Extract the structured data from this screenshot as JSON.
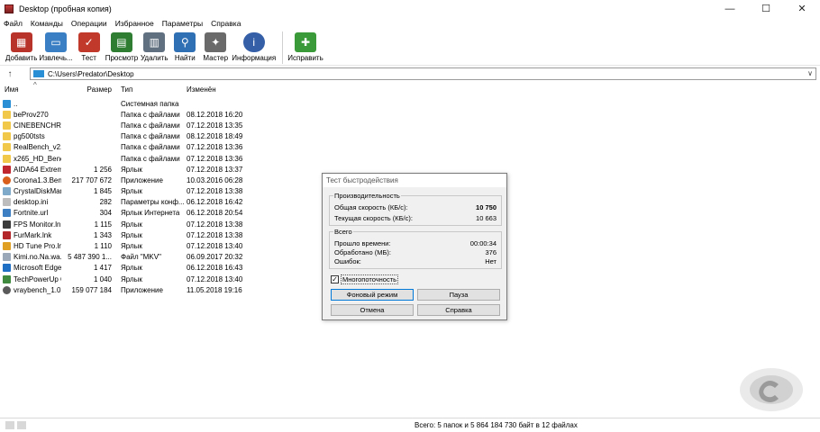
{
  "window": {
    "title": "Desktop (пробная копия)",
    "minimize": "—",
    "maximize": "☐",
    "close": "✕"
  },
  "menu": [
    "Файл",
    "Команды",
    "Операции",
    "Избранное",
    "Параметры",
    "Справка"
  ],
  "toolbar": [
    {
      "label": "Добавить",
      "icon": "archive-add-icon",
      "color": "#b8342a"
    },
    {
      "label": "Извлечь...",
      "icon": "folder-extract-icon",
      "color": "#3a7fc4"
    },
    {
      "label": "Тест",
      "icon": "test-icon",
      "color": "#c0392b"
    },
    {
      "label": "Просмотр",
      "icon": "view-book-icon",
      "color": "#2e7d32"
    },
    {
      "label": "Удалить",
      "icon": "trash-icon",
      "color": "#607080"
    },
    {
      "label": "Найти",
      "icon": "magnifier-icon",
      "color": "#2f6fb3"
    },
    {
      "label": "Мастер",
      "icon": "wizard-wand-icon",
      "color": "#6a6a6a"
    },
    {
      "label": "Информация",
      "icon": "info-icon",
      "color": "#3560a8"
    },
    {
      "label": "Исправить",
      "icon": "repair-icon",
      "color": "#3a9a3a"
    }
  ],
  "address": {
    "path": "C:\\Users\\Predator\\Desktop",
    "dropdown": "∨",
    "up": "↑"
  },
  "columns": {
    "name": "Имя",
    "size": "Размер",
    "type": "Тип",
    "modified": "Изменён",
    "sort_caret": "^"
  },
  "files": [
    {
      "name": "..",
      "size": "",
      "type": "Системная папка",
      "modified": "",
      "icon": "system-folder-icon",
      "color": "#2b8fd6"
    },
    {
      "name": "beProv270",
      "size": "",
      "type": "Папка с файлами",
      "modified": "08.12.2018 16:20",
      "icon": "folder-icon",
      "color": "#f2c84b"
    },
    {
      "name": "CINEBENCHR15...",
      "size": "",
      "type": "Папка с файлами",
      "modified": "07.12.2018 13:35",
      "icon": "folder-icon",
      "color": "#f2c84b"
    },
    {
      "name": "pg500tsts",
      "size": "",
      "type": "Папка с файлами",
      "modified": "08.12.2018 18:49",
      "icon": "folder-icon",
      "color": "#f2c84b"
    },
    {
      "name": "RealBench_v2.43",
      "size": "",
      "type": "Папка с файлами",
      "modified": "07.12.2018 13:36",
      "icon": "folder-icon",
      "color": "#f2c84b"
    },
    {
      "name": "x265_HD_Bench...",
      "size": "",
      "type": "Папка с файлами",
      "modified": "07.12.2018 13:36",
      "icon": "folder-icon",
      "color": "#f2c84b"
    },
    {
      "name": "AIDA64 Extreme...",
      "size": "1 256",
      "type": "Ярлык",
      "modified": "07.12.2018 13:37",
      "icon": "aida64-icon",
      "color": "#c0262d"
    },
    {
      "name": "Corona1.3.Benc...",
      "size": "217 707 672",
      "type": "Приложение",
      "modified": "10.03.2016 06:28",
      "icon": "corona-icon",
      "color": "#d8601c"
    },
    {
      "name": "CrystalDiskMark...",
      "size": "1 845",
      "type": "Ярлык",
      "modified": "07.12.2018 13:38",
      "icon": "crystaldiskmark-icon",
      "color": "#7fa9c9"
    },
    {
      "name": "desktop.ini",
      "size": "282",
      "type": "Параметры конф...",
      "modified": "06.12.2018 16:42",
      "icon": "ini-file-icon",
      "color": "#bdbdbd"
    },
    {
      "name": "Fortnite.url",
      "size": "304",
      "type": "Ярлык Интернета",
      "modified": "06.12.2018 20:54",
      "icon": "url-file-icon",
      "color": "#3d7fc2"
    },
    {
      "name": "FPS Monitor.lnk",
      "size": "1 115",
      "type": "Ярлык",
      "modified": "07.12.2018 13:38",
      "icon": "fps-monitor-icon",
      "color": "#3b3b3b"
    },
    {
      "name": "FurMark.lnk",
      "size": "1 343",
      "type": "Ярлык",
      "modified": "07.12.2018 13:38",
      "icon": "furmark-icon",
      "color": "#b3262a"
    },
    {
      "name": "HD Tune Pro.lnk",
      "size": "1 110",
      "type": "Ярлык",
      "modified": "07.12.2018 13:40",
      "icon": "hdtune-icon",
      "color": "#e0a024"
    },
    {
      "name": "Kimi.no.Na.wa.2...",
      "size": "5 487 390 1...",
      "type": "Файл \"MKV\"",
      "modified": "06.09.2017 20:32",
      "icon": "video-file-icon",
      "color": "#9aa8b8"
    },
    {
      "name": "Microsoft Edge.l...",
      "size": "1 417",
      "type": "Ярлык",
      "modified": "06.12.2018 16:43",
      "icon": "edge-icon",
      "color": "#1f6fc4"
    },
    {
      "name": "TechPowerUp G...",
      "size": "1 040",
      "type": "Ярлык",
      "modified": "07.12.2018 13:40",
      "icon": "gpuz-icon",
      "color": "#3f8a3f"
    },
    {
      "name": "vraybench_1.0.8...",
      "size": "159 077 184",
      "type": "Приложение",
      "modified": "11.05.2018 19:16",
      "icon": "vray-icon",
      "color": "#5a5a5a"
    }
  ],
  "dialog": {
    "title": "Тест быстродействия",
    "perf_group": "Производительность",
    "overall_label": "Общая скорость (КБ/с):",
    "overall_value": "10 750",
    "current_label": "Текущая скорость (КБ/с):",
    "current_value": "10 663",
    "total_group": "Всего",
    "elapsed_label": "Прошло времени:",
    "elapsed_value": "00:00:34",
    "processed_label": "Обработано (МБ):",
    "processed_value": "376",
    "errors_label": "Ошибок:",
    "errors_value": "Нет",
    "multithread_label": "Многопоточность",
    "multithread_checked": "✓",
    "btn_background": "Фоновый режим",
    "btn_pause": "Пауза",
    "btn_cancel": "Отмена",
    "btn_help": "Справка"
  },
  "status": {
    "text": "Всего: 5 папок и 5 864 184 730 байт в 12 файлах"
  }
}
